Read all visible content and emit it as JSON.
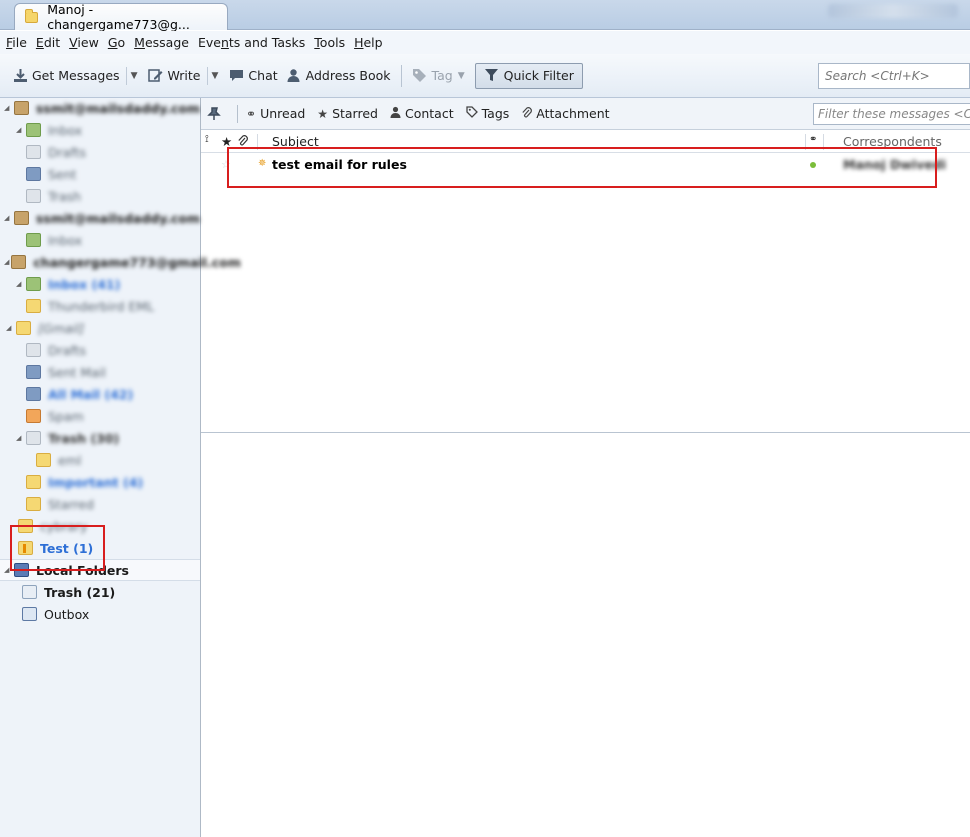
{
  "window": {
    "tab_title": "Manoj - changergame773@g...",
    "tab_icon": "folder-icon"
  },
  "menu": [
    {
      "label": "File",
      "accel": "F"
    },
    {
      "label": "Edit",
      "accel": "E"
    },
    {
      "label": "View",
      "accel": "V"
    },
    {
      "label": "Go",
      "accel": "G"
    },
    {
      "label": "Message",
      "accel": "M"
    },
    {
      "label": "Events and Tasks",
      "accel": "n"
    },
    {
      "label": "Tools",
      "accel": "T"
    },
    {
      "label": "Help",
      "accel": "H"
    }
  ],
  "toolbar": {
    "get_messages": "Get Messages",
    "write": "Write",
    "chat": "Chat",
    "address_book": "Address Book",
    "tag": "Tag",
    "quick_filter": "Quick Filter",
    "search_placeholder": "Search <Ctrl+K>"
  },
  "quick_filter_bar": {
    "unread": "Unread",
    "starred": "Starred",
    "contact": "Contact",
    "tags": "Tags",
    "attachment": "Attachment",
    "filter_placeholder": "Filter these messages <Ctrl+Shift+K>"
  },
  "folders": {
    "account1": "ssmit@mailsdaddy.com",
    "account1_inbox": "Inbox",
    "account1_drafts": "Drafts",
    "account1_sent": "Sent",
    "account1_trash": "Trash",
    "account2": "ssmit@mailsdaddy.com",
    "account2_inbox": "Inbox",
    "account3": "changergame773@gmail.com",
    "account3_inbox": "Inbox (41)",
    "account3_thunderbird": "Thunderbird EML",
    "account3_gmail": "[Gmail]",
    "account3_drafts": "Drafts",
    "account3_sentmail": "Sent Mail",
    "account3_allmail": "All Mail (42)",
    "account3_spam": "Spam",
    "account3_trash": "Trash (30)",
    "account3_eml": "eml",
    "account3_important": "Important (4)",
    "account3_starred": "Starred",
    "account3_cybrary": "cybrary",
    "test": "Test (1)",
    "local_folders": "Local Folders",
    "local_trash": "Trash (21)",
    "local_outbox": "Outbox"
  },
  "thread": {
    "columns": {
      "subject": "Subject",
      "correspondents": "Correspondents"
    },
    "messages": [
      {
        "subject": "test email for rules",
        "correspondent": "Manoj Dwivedi",
        "status": "unread"
      }
    ]
  },
  "colors": {
    "highlight_box": "#d81e1e",
    "unread_folder_text": "#2d6fd6"
  }
}
